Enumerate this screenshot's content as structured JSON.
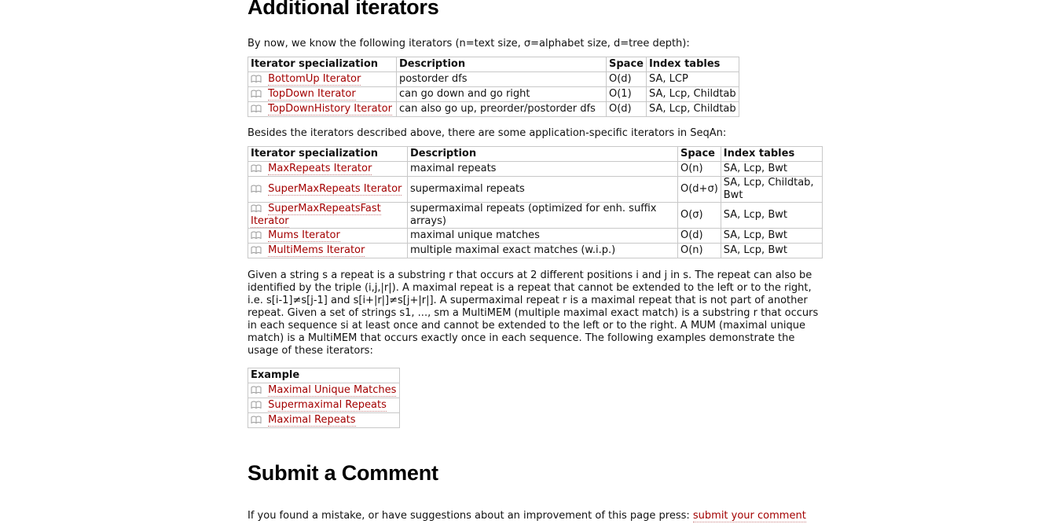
{
  "section_title": "Additional iterators",
  "intro": "By now, we know the following iterators (n=text size, σ=alphabet size, d=tree depth):",
  "table1": {
    "headers": [
      "Iterator specialization",
      "Description",
      "Space",
      "Index tables"
    ],
    "rows": [
      {
        "link": "BottomUp Iterator",
        "desc": "postorder dfs",
        "space": "O(d)",
        "tables": "SA, LCP"
      },
      {
        "link": "TopDown Iterator",
        "desc": "can go down and go right",
        "space": "O(1)",
        "tables": "SA, Lcp, Childtab"
      },
      {
        "link": "TopDownHistory Iterator",
        "desc": "can also go up, preorder/postorder dfs",
        "space": "O(d)",
        "tables": "SA, Lcp, Childtab"
      }
    ]
  },
  "besides": "Besides the iterators described above, there are some application-specific iterators in SeqAn:",
  "table2": {
    "headers": [
      "Iterator specialization",
      "Description",
      "Space",
      "Index tables"
    ],
    "rows": [
      {
        "link": "MaxRepeats Iterator",
        "desc": "maximal repeats",
        "space": "O(n)",
        "tables": "SA, Lcp, Bwt"
      },
      {
        "link": "SuperMaxRepeats Iterator",
        "desc": "supermaximal repeats",
        "space": "O(d+σ)",
        "tables": "SA, Lcp, Childtab, Bwt"
      },
      {
        "link": "SuperMaxRepeatsFast Iterator",
        "desc": "supermaximal repeats (optimized for enh. suffix arrays)",
        "space": "O(σ)",
        "tables": "SA, Lcp, Bwt"
      },
      {
        "link": "Mums Iterator",
        "desc": "maximal unique matches",
        "space": "O(d)",
        "tables": "SA, Lcp, Bwt"
      },
      {
        "link": "MultiMems Iterator",
        "desc": "multiple maximal exact matches (w.i.p.)",
        "space": "O(n)",
        "tables": "SA, Lcp, Bwt"
      }
    ]
  },
  "description": "Given a string s a repeat is a substring r that occurs at 2 different positions i and j in s. The repeat can also be identified by the triple (i,j,|r|). A maximal repeat is a repeat that cannot be extended to the left or to the right, i.e. s[i-1]≠s[j-1] and s[i+|r|]≠s[j+|r|]. A supermaximal repeat r is a maximal repeat that is not part of another repeat. Given a set of strings s1, ..., sm a MultiMEM (multiple maximal exact match) is a substring r that occurs in each sequence si at least once and cannot be extended to the left or to the right. A MUM (maximal unique match) is a MultiMEM that occurs exactly once in each sequence. The following examples demonstrate the usage of these iterators:",
  "table3": {
    "header": "Example",
    "rows": [
      {
        "link": "Maximal Unique Matches"
      },
      {
        "link": "Supermaximal Repeats"
      },
      {
        "link": "Maximal Repeats"
      }
    ]
  },
  "comment_title": "Submit a Comment",
  "submit_text": "If you found a mistake, or have suggestions about an improvement of this page press:",
  "submit_link": "submit your comment",
  "icons": {
    "row_icon": "book-icon"
  },
  "colors": {
    "link": "#a30000",
    "border": "#c8c8c8"
  }
}
